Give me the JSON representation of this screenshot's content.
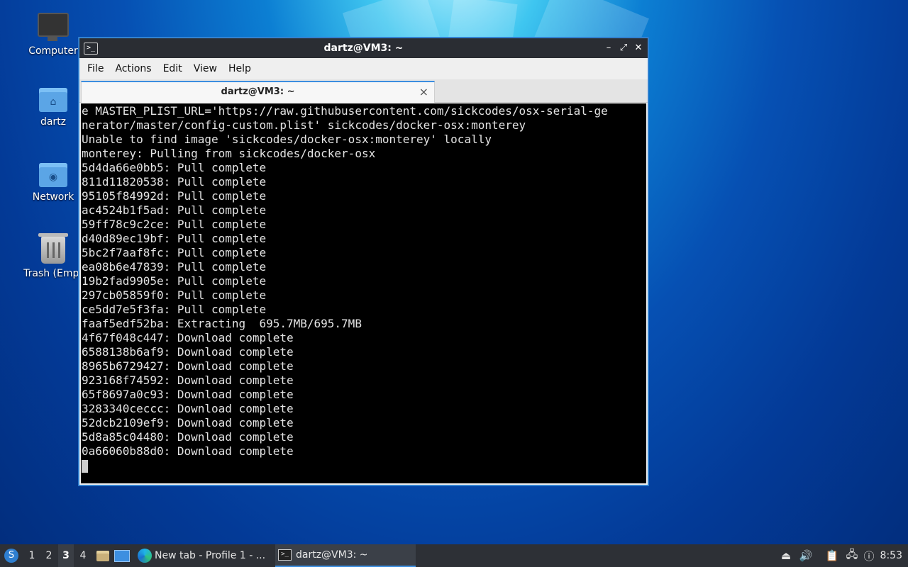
{
  "desktop": {
    "icons": [
      {
        "label": "Computer",
        "icon": "computer-icon"
      },
      {
        "label": "dartz",
        "icon": "home-folder-icon"
      },
      {
        "label": "Network",
        "icon": "network-folder-icon"
      },
      {
        "label": "Trash (Empt",
        "icon": "trash-icon"
      }
    ]
  },
  "window": {
    "title": "dartz@VM3: ~",
    "menu": [
      "File",
      "Actions",
      "Edit",
      "View",
      "Help"
    ],
    "tab_label": "dartz@VM3: ~",
    "tab_close": "×",
    "controls": {
      "minimize": "–",
      "maximize": "⤢",
      "close": "✕"
    }
  },
  "terminal": {
    "lines": [
      "e MASTER_PLIST_URL='https://raw.githubusercontent.com/sickcodes/osx-serial-ge",
      "nerator/master/config-custom.plist' sickcodes/docker-osx:monterey",
      "Unable to find image 'sickcodes/docker-osx:monterey' locally",
      "monterey: Pulling from sickcodes/docker-osx",
      "5d4da66e0bb5: Pull complete",
      "811d11820538: Pull complete",
      "95105f84992d: Pull complete",
      "ac4524b1f5ad: Pull complete",
      "59ff78c9c2ce: Pull complete",
      "d40d89ec19bf: Pull complete",
      "5bc2f7aaf8fc: Pull complete",
      "ea08b6e47839: Pull complete",
      "19b2fad9905e: Pull complete",
      "297cb05859f0: Pull complete",
      "ce5dd7e5f3fa: Pull complete",
      "faaf5edf52ba: Extracting  695.7MB/695.7MB",
      "4f67f048c447: Download complete",
      "6588138b6af9: Download complete",
      "8965b6729427: Download complete",
      "923168f74592: Download complete",
      "65f8697a0c93: Download complete",
      "3283340ceccc: Download complete",
      "52dcb2109ef9: Download complete",
      "5d8a85c04480: Download complete",
      "0a66060b88d0: Download complete"
    ]
  },
  "taskbar": {
    "start_glyph": "S",
    "workspaces": [
      "1",
      "2",
      "3",
      "4"
    ],
    "active_workspace": "3",
    "tasks": [
      {
        "label": "New tab - Profile 1 - ...",
        "icon": "edge-browser-icon"
      },
      {
        "label": "dartz@VM3: ~",
        "icon": "terminal-icon"
      }
    ],
    "clock": "8:53"
  }
}
